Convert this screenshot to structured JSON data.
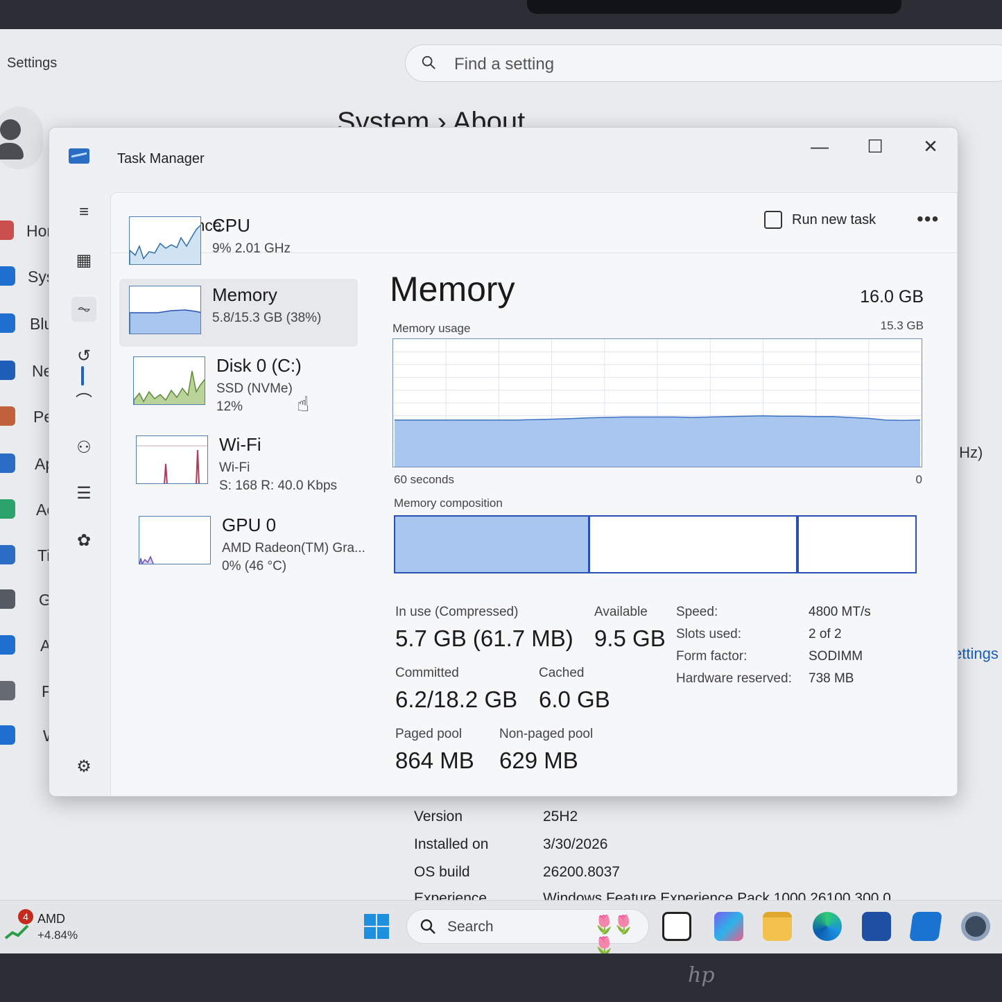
{
  "settings": {
    "app_title": "Settings",
    "search_placeholder": "Find a setting",
    "breadcrumb_parent": "System",
    "breadcrumb_current": "About",
    "nav": [
      {
        "label": "Hor",
        "icon": "home-icon",
        "color": "#c94f4f"
      },
      {
        "label": "Syst",
        "icon": "system-icon",
        "color": "#1f6fd1"
      },
      {
        "label": "Blue",
        "icon": "bluetooth-icon",
        "color": "#1f6fd1"
      },
      {
        "label": "Net",
        "icon": "network-icon",
        "color": "#1f5fb8"
      },
      {
        "label": "Pers",
        "icon": "brush-icon",
        "color": "#c0613b"
      },
      {
        "label": "App",
        "icon": "apps-icon",
        "color": "#2b6cc4"
      },
      {
        "label": "Acc",
        "icon": "accounts-icon",
        "color": "#2ba36b"
      },
      {
        "label": "Tim",
        "icon": "time-icon",
        "color": "#2b6cc4"
      },
      {
        "label": "Gar",
        "icon": "gaming-icon",
        "color": "#555a63"
      },
      {
        "label": "Acc",
        "icon": "accessibility-icon",
        "color": "#1f6fd1"
      },
      {
        "label": "Priv",
        "icon": "shield-icon",
        "color": "#666b73"
      },
      {
        "label": "Win",
        "icon": "update-icon",
        "color": "#1f6fd1"
      }
    ],
    "side_fragments": {
      "ghz": "GHz)",
      "settings_link": "settings"
    },
    "about_rows": [
      {
        "key": "Version",
        "value": "25H2"
      },
      {
        "key": "Installed on",
        "value": "3/30/2026"
      },
      {
        "key": "OS build",
        "value": "26200.8037"
      },
      {
        "key": "Experience",
        "value": "Windows Feature Experience Pack 1000.26100.300.0"
      }
    ]
  },
  "taskbar": {
    "widget_badge": "4",
    "widget_name": "AMD",
    "widget_change": "+4.84%",
    "search_label": "Search",
    "search_decoration": "🌷🌷🌷",
    "apps": [
      "terminal-icon",
      "m365-icon",
      "file-explorer-icon",
      "edge-icon",
      "store-icon",
      "outlook-icon",
      "settings-gear-icon"
    ]
  },
  "task_manager": {
    "title": "Task Manager",
    "minimize": "—",
    "maximize": "☐",
    "close": "✕",
    "page_title": "Performance",
    "run_new_task": "Run new task",
    "more": "•••",
    "devices": [
      {
        "name": "CPU",
        "line2": "9%  2.01 GHz",
        "line3": ""
      },
      {
        "name": "Memory",
        "line2": "5.8/15.3 GB (38%)",
        "line3": ""
      },
      {
        "name": "Disk 0 (C:)",
        "line2": "SSD (NVMe)",
        "line3": "12%"
      },
      {
        "name": "Wi-Fi",
        "line2": "Wi-Fi",
        "line3": "S: 168  R: 40.0 Kbps"
      },
      {
        "name": "GPU 0",
        "line2": "AMD Radeon(TM) Gra...",
        "line3": "0%  (46 °C)"
      }
    ],
    "memory": {
      "title": "Memory",
      "total": "16.0 GB",
      "usage_label": "Memory usage",
      "usage_max": "15.3 GB",
      "x_left": "60 seconds",
      "x_right": "0",
      "composition_label": "Memory composition",
      "usage_history_gb": [
        5.6,
        5.6,
        5.6,
        5.6,
        5.6,
        5.6,
        5.6,
        5.6,
        5.65,
        5.7,
        5.75,
        5.85,
        5.9,
        5.95,
        5.95,
        5.95,
        5.95,
        5.9,
        5.95,
        6.0,
        6.05,
        6.1,
        6.05,
        6.05,
        6.0,
        6.0,
        5.9,
        5.8,
        5.6,
        5.55,
        5.6
      ],
      "composition": {
        "in_use_fraction": 0.375,
        "modified_fraction": 0.005,
        "standby_fraction": 0.39,
        "free_fraction": 0.23
      },
      "in_use_label": "In use (Compressed)",
      "in_use_value": "5.7 GB (61.7 MB)",
      "available_label": "Available",
      "available_value": "9.5 GB",
      "committed_label": "Committed",
      "committed_value": "6.2/18.2 GB",
      "cached_label": "Cached",
      "cached_value": "6.0 GB",
      "paged_label": "Paged pool",
      "paged_value": "864 MB",
      "nonpaged_label": "Non-paged pool",
      "nonpaged_value": "629 MB",
      "specs": [
        {
          "key": "Speed:",
          "value": "4800 MT/s"
        },
        {
          "key": "Slots used:",
          "value": "2 of 2"
        },
        {
          "key": "Form factor:",
          "value": "SODIMM"
        },
        {
          "key": "Hardware reserved:",
          "value": "738 MB"
        }
      ]
    },
    "colors": {
      "memory_fill": "#a9c7ee",
      "memory_line": "#2a50b5",
      "cpu_line": "#2f6ea5",
      "disk_fill": "#b9d39a",
      "wifi_spike": "#b03a5a",
      "gpu_line": "#6d4fb0"
    }
  }
}
